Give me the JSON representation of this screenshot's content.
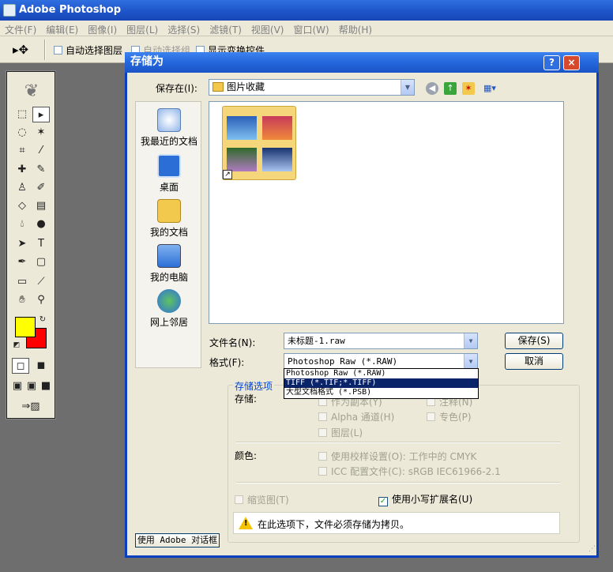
{
  "app": {
    "title": "Adobe Photoshop"
  },
  "menubar": {
    "items": [
      "文件(F)",
      "编辑(E)",
      "图像(I)",
      "图层(L)",
      "选择(S)",
      "滤镜(T)",
      "视图(V)",
      "窗口(W)",
      "帮助(H)"
    ]
  },
  "options_bar": {
    "auto_select_layer": "自动选择图层",
    "auto_select_group": "自动选择组",
    "show_transform": "显示变换控件"
  },
  "dialog": {
    "title": "存储为",
    "help_label": "?",
    "close_label": "×",
    "save_in_label": "保存在(I):",
    "save_in_value": "图片收藏",
    "places": [
      "我最近的文档",
      "桌面",
      "我的文档",
      "我的电脑",
      "网上邻居"
    ],
    "filename_label": "文件名(N):",
    "filename_value": "未标题-1.raw",
    "format_label": "格式(F):",
    "format_value": "Photoshop Raw (*.RAW)",
    "format_options": [
      "Photoshop Raw (*.RAW)",
      "TIFF (*.TIF;*.TIFF)",
      "大型文档格式 (*.PSB)"
    ],
    "save_button": "保存(S)",
    "cancel_button": "取消",
    "save_options": {
      "title": "存储选项",
      "save_label": "存储:",
      "as_copy": "作为副本(Y)",
      "annotations": "注释(N)",
      "alpha": "Alpha 通道(H)",
      "spot": "专色(P)",
      "layers": "图层(L)",
      "color_label": "颜色:",
      "use_proof": "使用校样设置(O): 工作中的 CMYK",
      "icc": "ICC 配置文件(C): sRGB IEC61966-2.1",
      "thumbnail": "缩览图(T)",
      "lowercase": "使用小写扩展名(U)",
      "warning": "在此选项下，文件必须存储为拷贝。"
    },
    "adobe_dialog_button": "使用 Adobe 对话框"
  },
  "colors": {
    "foreground": "#ffff00",
    "background": "#ff0000",
    "title_blue": "#0a3fc0"
  }
}
